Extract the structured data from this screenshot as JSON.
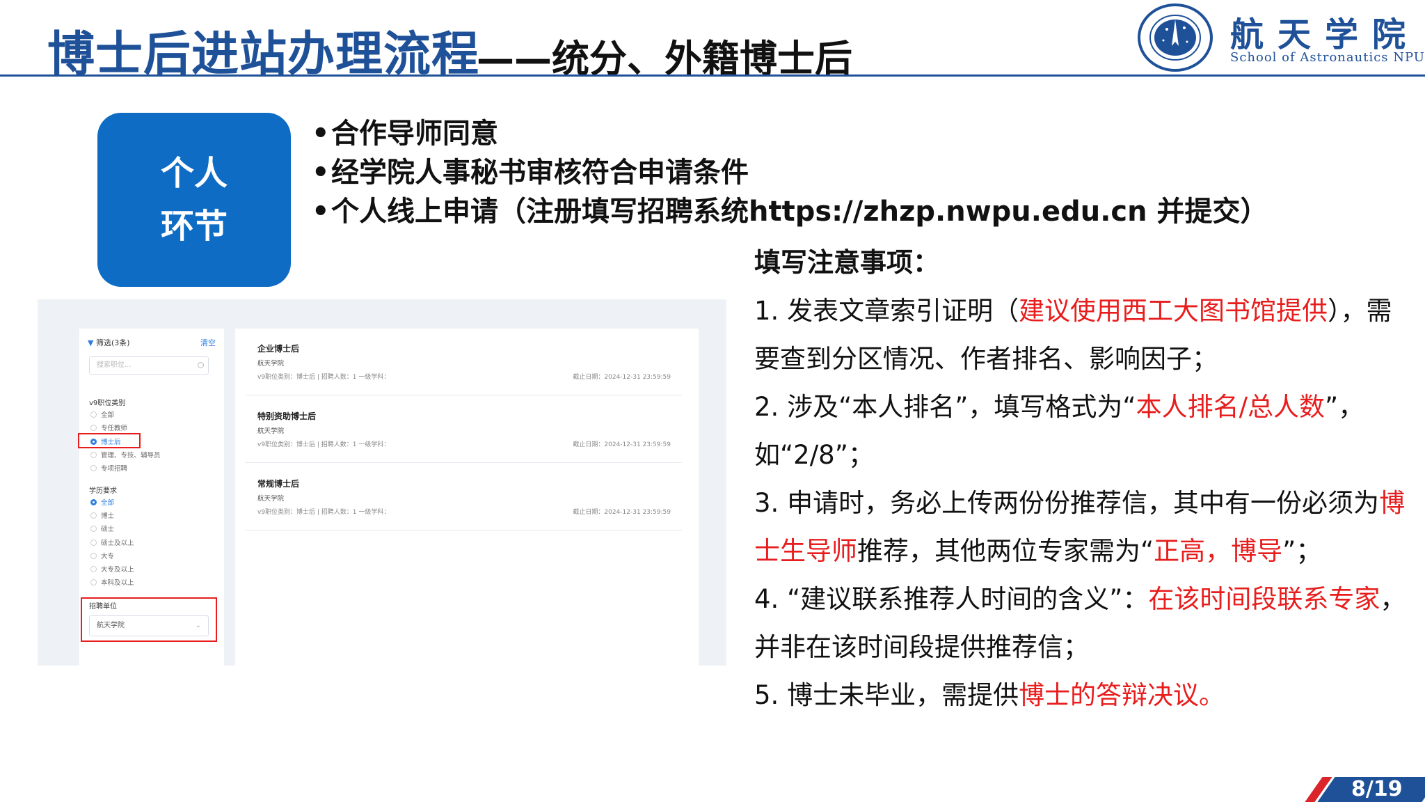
{
  "header": {
    "title_main": "博士后进站办理流程",
    "title_sub": "——统分、外籍博士后",
    "school_cn": "航天学院",
    "school_en": "School of Astronautics NPU"
  },
  "step_box": {
    "line1": "个人",
    "line2": "环节"
  },
  "bullets": [
    "合作导师同意",
    "经学院人事秘书审核符合申请条件",
    "个人线上申请（注册填写招聘系统https://zhzp.nwpu.edu.cn 并提交）"
  ],
  "notes": {
    "title": "填写注意事项：",
    "n1_a": "1. 发表文章索引证明（",
    "n1_red": "建议使用西工大图书馆提供",
    "n1_b": "），需要查到分区情况、作者排名、影响因子；",
    "n2_a": "2. 涉及“本人排名”，填写格式为“",
    "n2_red": "本人排名/总人数",
    "n2_b": "”，如“2/8”；",
    "n3_a": "3. 申请时，务必上传两份份推荐信，其中有一份必须为",
    "n3_red1": "博士生导师",
    "n3_b": "推荐，其他两位专家需为“",
    "n3_red2": "正高，博导",
    "n3_c": "”；",
    "n4_a": "4. “建议联系推荐人时间的含义”：",
    "n4_red": "在该时间段联系专家",
    "n4_b": "，并非在该时间段提供推荐信；",
    "n5_a": "5. 博士未毕业，需提供",
    "n5_red": "博士的答辩决议。"
  },
  "screenshot": {
    "filter": {
      "title": "筛选(3条)",
      "clear": "清空",
      "search_placeholder": "搜索职位...",
      "group1_title": "v9职位类别",
      "group1_options": [
        "全部",
        "专任教师",
        "博士后",
        "管理、专技、辅导员",
        "专项招聘"
      ],
      "group1_selected": "博士后",
      "group2_title": "学历要求",
      "group2_options": [
        "全部",
        "博士",
        "硕士",
        "硕士及以上",
        "大专",
        "大专及以上",
        "本科及以上"
      ],
      "group2_selected": "全部",
      "unit_title": "招聘单位",
      "unit_value": "航天学院"
    },
    "jobs": [
      {
        "title": "企业博士后",
        "org": "航天学院",
        "meta": "v9职位类别：博士后  |  招聘人数：1 一级学科：",
        "deadline": "截止日期：2024-12-31 23:59:59"
      },
      {
        "title": "特别资助博士后",
        "org": "航天学院",
        "meta": "v9职位类别：博士后  |  招聘人数：1 一级学科：",
        "deadline": "截止日期：2024-12-31 23:59:59"
      },
      {
        "title": "常规博士后",
        "org": "航天学院",
        "meta": "v9职位类别：博士后  |  招聘人数：1 一级学科：",
        "deadline": "截止日期：2024-12-31 23:59:59"
      }
    ]
  },
  "page_number": "8/19",
  "colors": {
    "brand_blue": "#1f5199",
    "box_blue": "#0e6cc4",
    "highlight_red": "#e81d1d"
  }
}
